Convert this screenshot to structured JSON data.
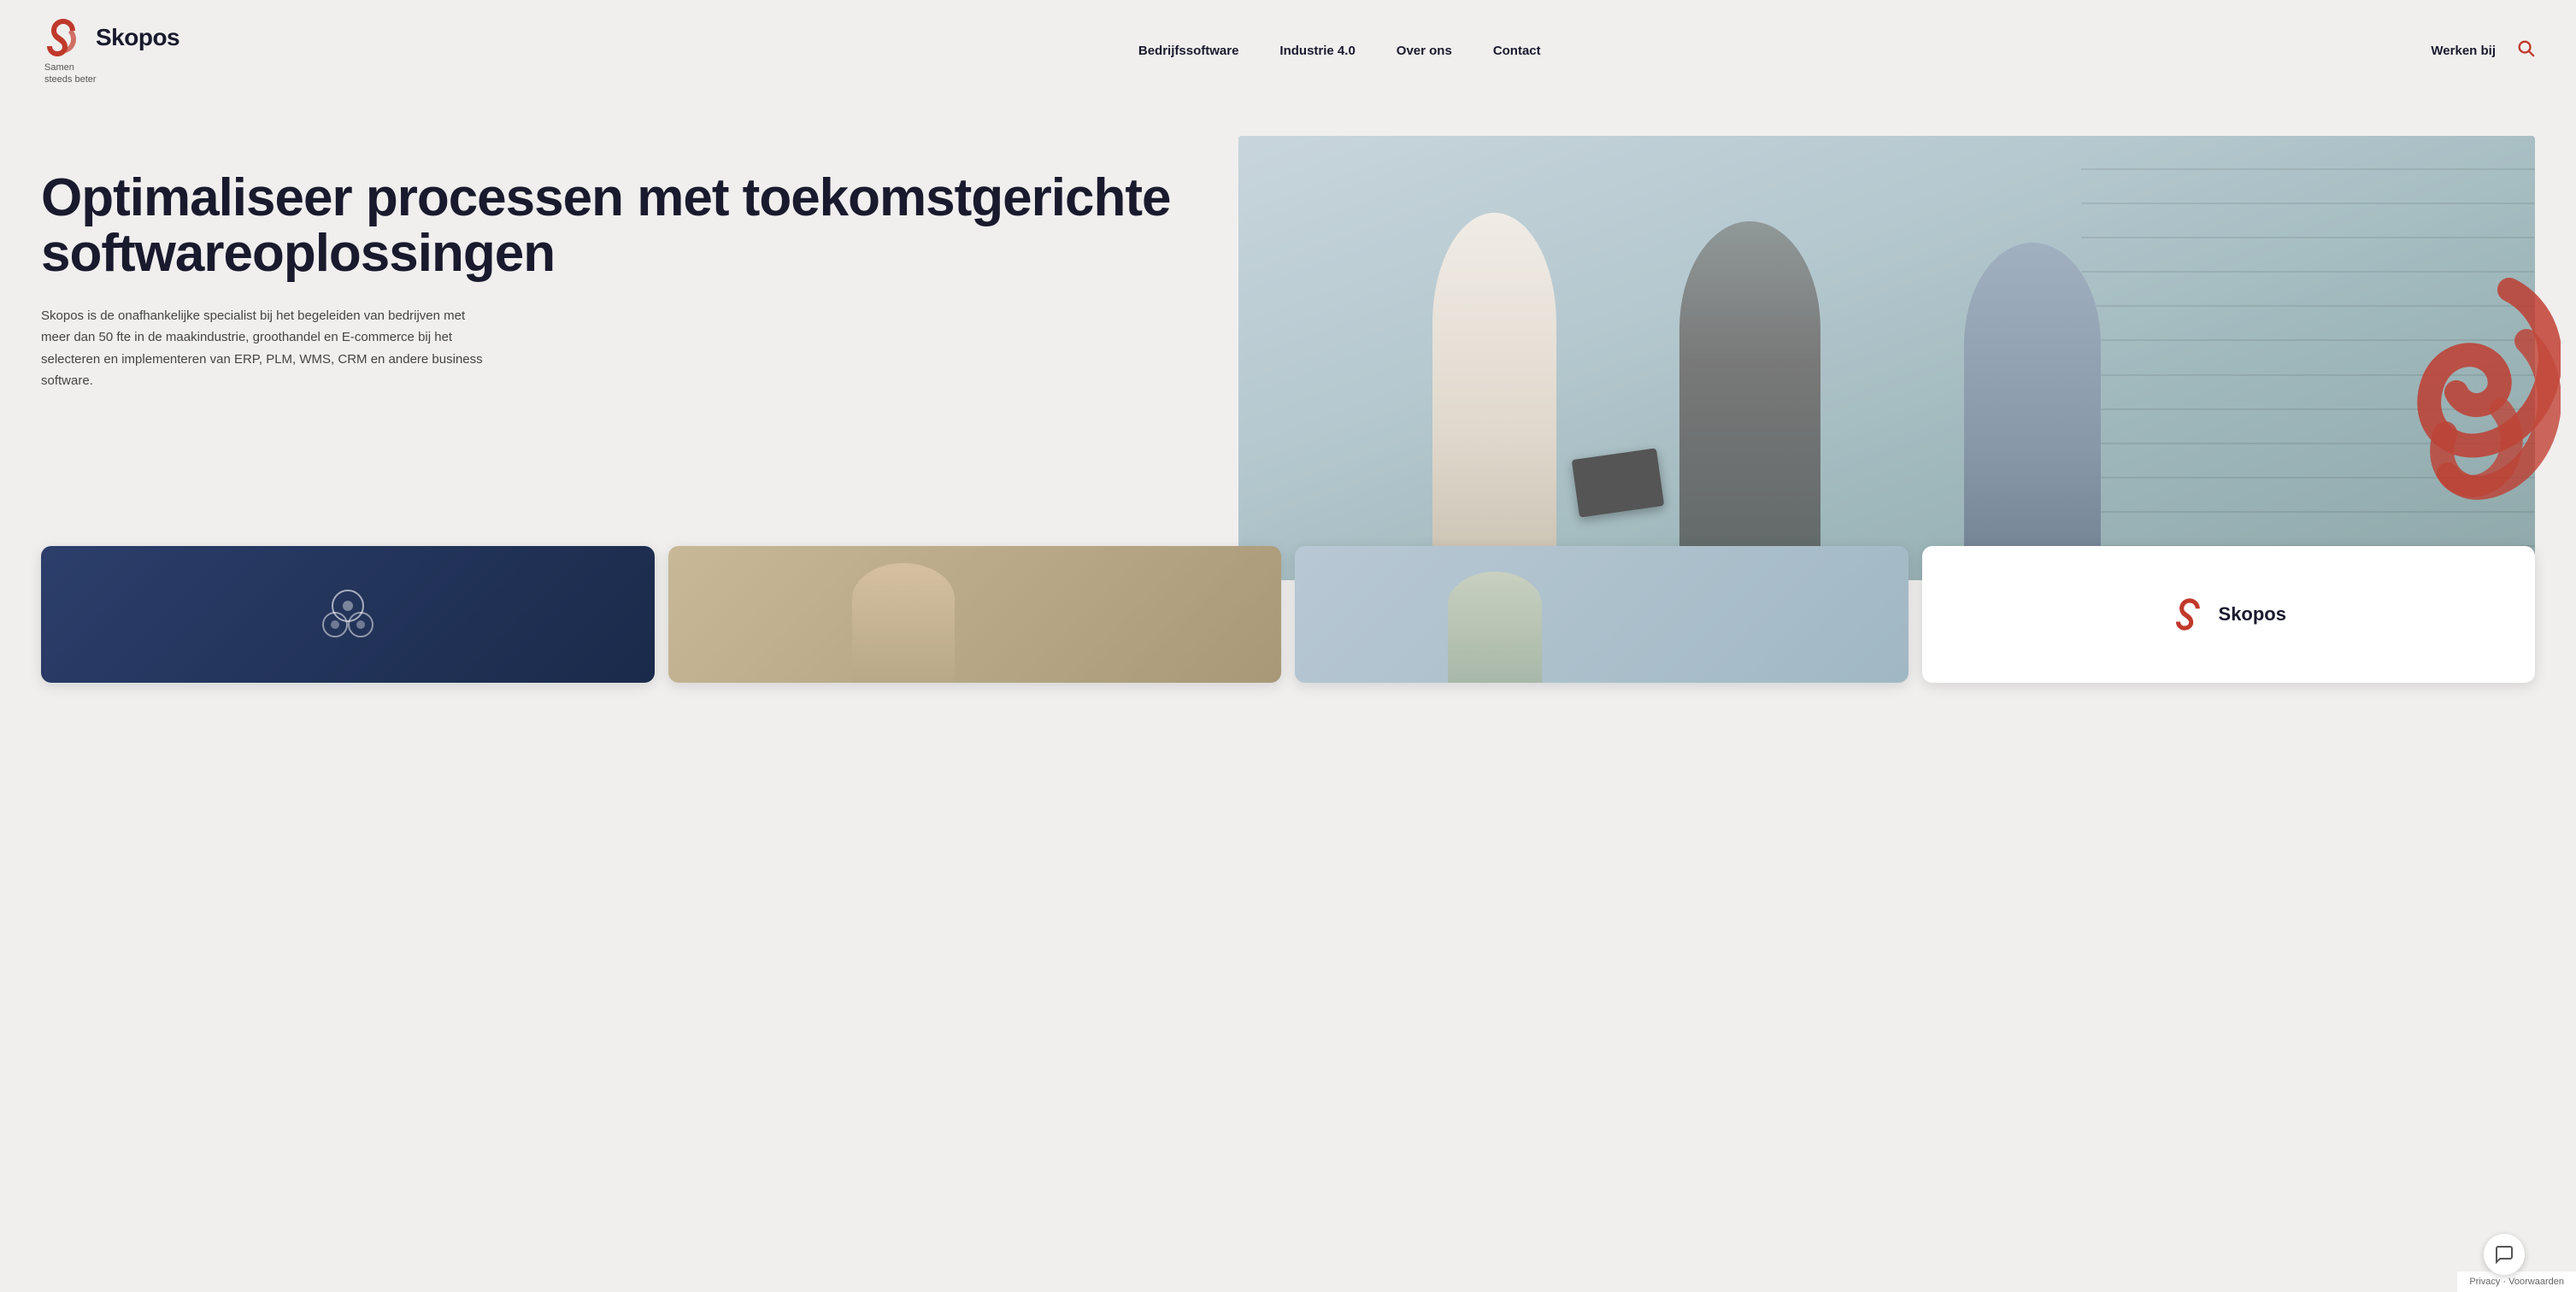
{
  "header": {
    "logo_name": "Skopos",
    "logo_tagline_line1": "Samen",
    "logo_tagline_line2": "steeds beter",
    "nav": [
      {
        "label": "Bedrijfssoftware",
        "id": "bedrijfssoftware"
      },
      {
        "label": "Industrie 4.0",
        "id": "industrie-4"
      },
      {
        "label": "Over ons",
        "id": "over-ons"
      },
      {
        "label": "Contact",
        "id": "contact"
      }
    ],
    "werken_bij": "Werken bij",
    "search_icon": "🔍"
  },
  "hero": {
    "title": "Optimaliseer processen met toekomstgerichte softwareoplossingen",
    "description": "Skopos is de onafhankelijke specialist bij het begeleiden van bedrijven met meer dan 50 fte in de maakindustrie, groothandel en E-commerce bij het selecteren en implementeren van ERP, PLM, WMS, CRM en andere business software.",
    "card4_logo": "Skopos"
  },
  "footer": {
    "privacy_text": "Privacy · Voorwaarden"
  },
  "colors": {
    "accent": "#c0392b",
    "dark": "#1a1a2e",
    "bg": "#f0efee"
  }
}
